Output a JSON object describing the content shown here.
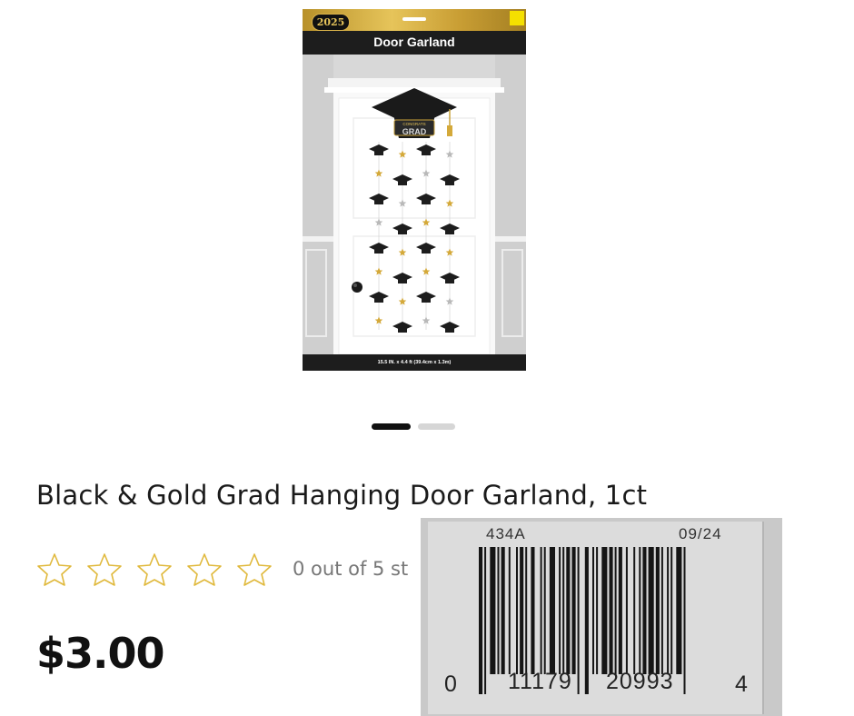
{
  "product_image": {
    "package_year": "2025",
    "package_title": "Door Garland",
    "package_cap_text_top": "CONGRATS",
    "package_cap_text_bottom": "GRAD",
    "package_size": "15.5 IN. x 4.4 ft (39.4cm x 1.3m)",
    "colors": {
      "gold": "#d4a93a",
      "black": "#1d1d1d",
      "silver": "#b9b9b9"
    }
  },
  "carousel": {
    "total": 2,
    "active_index": 0
  },
  "product": {
    "title": "Black & Gold Grad Hanging Door Garland, 1ct",
    "rating_value": 0,
    "rating_max": 5,
    "rating_text": "0 out of 5 st",
    "price": "$3.00",
    "star_icon": "star-outline-icon",
    "star_color": "#e0b93c"
  },
  "barcode_label": {
    "code": "434A",
    "date": "09/24",
    "digit_first": "0",
    "digits_left": "11179",
    "digits_right": "20993",
    "digit_last": "4"
  }
}
